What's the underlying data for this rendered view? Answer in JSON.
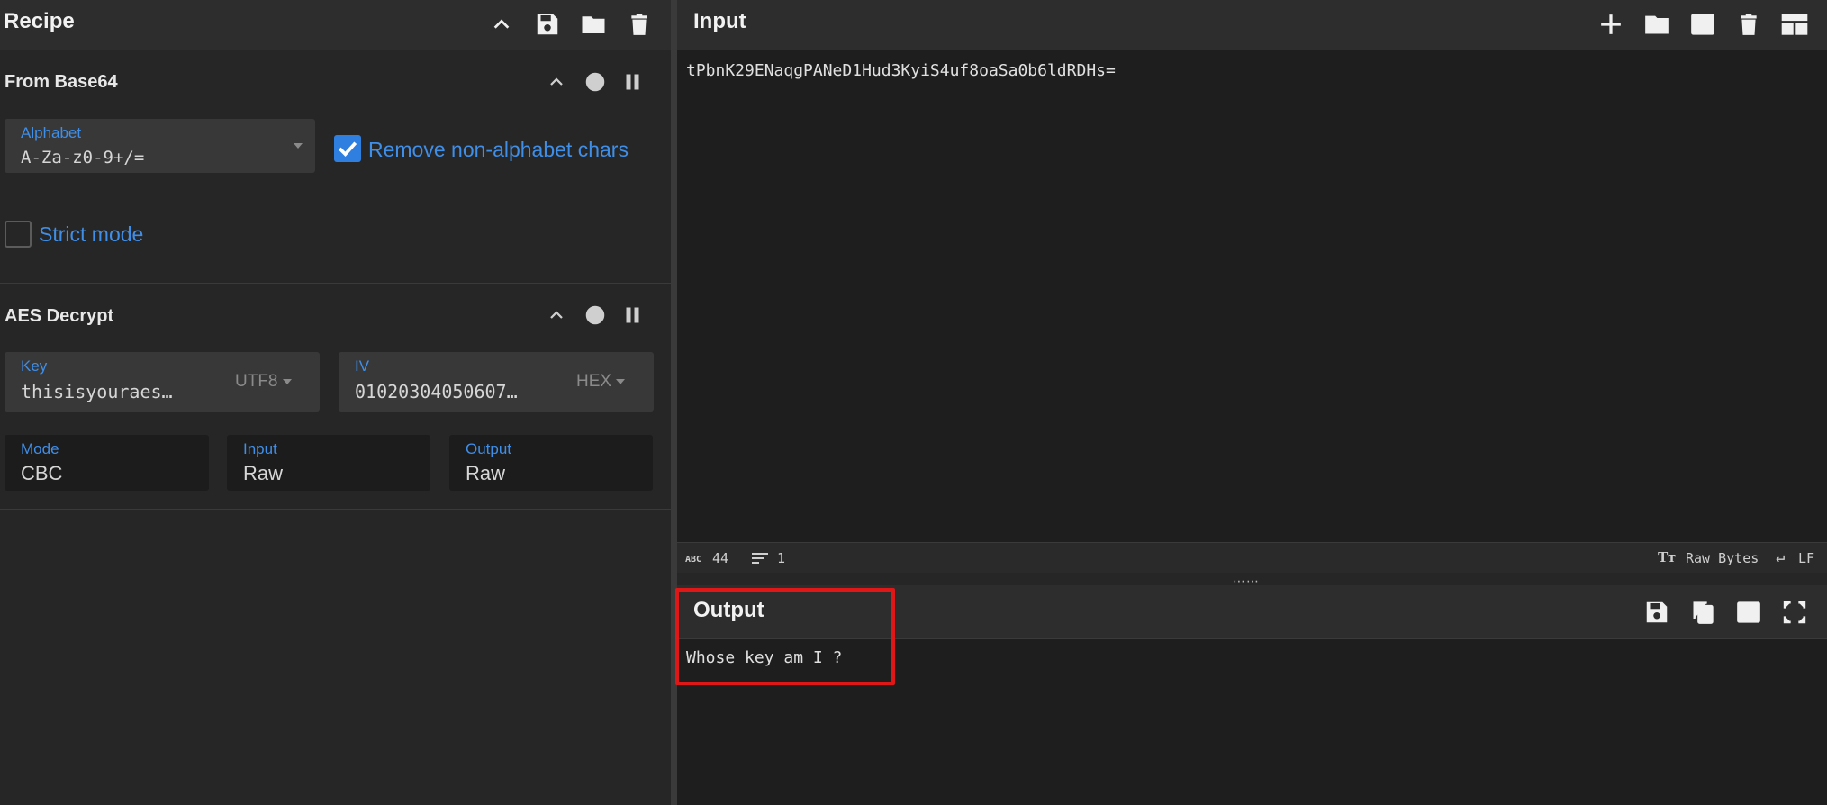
{
  "recipe": {
    "title": "Recipe",
    "operations": [
      {
        "title": "From Base64",
        "alphabet_label": "Alphabet",
        "alphabet_value": "A-Za-z0-9+/=",
        "remove_label": "Remove non-alphabet chars",
        "remove_checked": true,
        "strict_label": "Strict mode",
        "strict_checked": false
      },
      {
        "title": "AES Decrypt",
        "key_label": "Key",
        "key_value": "thisisyouraes…",
        "key_encoding": "UTF8",
        "iv_label": "IV",
        "iv_value": "01020304050607…",
        "iv_encoding": "HEX",
        "mode_label": "Mode",
        "mode_value": "CBC",
        "input_label": "Input",
        "input_value": "Raw",
        "output_label": "Output",
        "output_value": "Raw"
      }
    ]
  },
  "input": {
    "title": "Input",
    "text": "tPbnK29ENaqgPANeD1Hud3KyiS4uf8oaSa0b6ldRDHs=",
    "status": {
      "length": "44",
      "lines": "1",
      "encoding": "Raw Bytes",
      "eol": "LF"
    }
  },
  "output": {
    "title": "Output",
    "text": "Whose key am I ?"
  },
  "colors": {
    "accent": "#3f8ee8",
    "highlight": "#e01717"
  }
}
